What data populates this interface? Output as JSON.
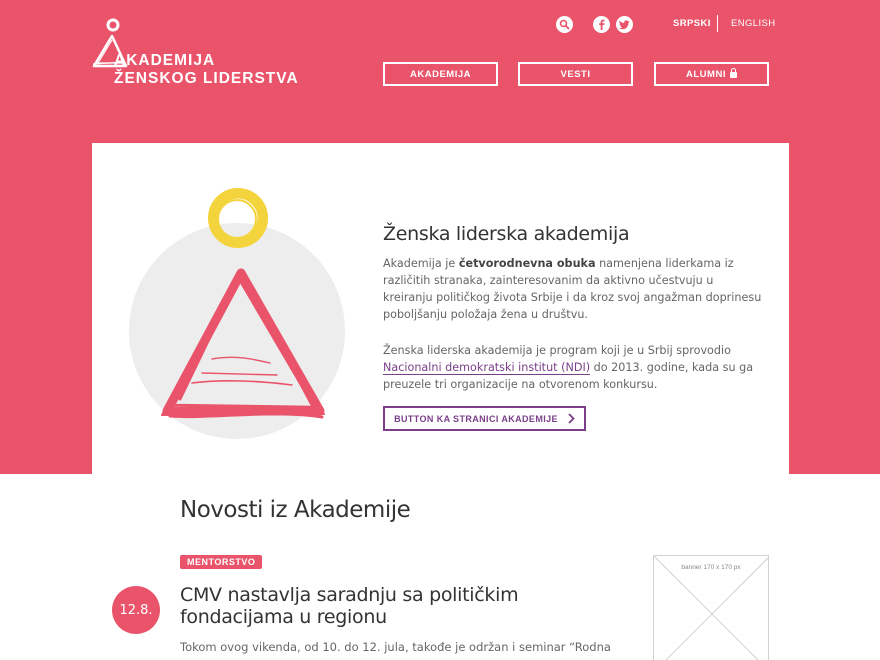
{
  "colors": {
    "brand": "#e9546b",
    "accent_purple": "#7b3f8a",
    "illustration_yellow": "#f3d43c"
  },
  "header": {
    "logo": {
      "line1": "AKADEMIJA",
      "line2": "ŽENSKOG LIDERSTVA"
    },
    "icons": {
      "search": "search-icon",
      "facebook": "facebook-icon",
      "twitter": "twitter-icon"
    },
    "languages": {
      "active": "SRPSKI",
      "other": "ENGLISH"
    },
    "nav": [
      {
        "label": "AKADEMIJA"
      },
      {
        "label": "VESTI"
      },
      {
        "label": "ALUMNI",
        "icon": "lock-icon"
      }
    ]
  },
  "hero": {
    "title": "Ženska liderska akademija",
    "p1_before": "Akademija je ",
    "p1_bold": "četvorodnevna obuka",
    "p1_after": " namenjena liderkama iz različitih stranaka, zainteresovanim da aktivno učestvuju u kreiranju političkog života Srbije i da kroz svoj angažman doprinesu poboljšanju položaja žena u društvu.",
    "p2_before": "Ženska liderska akademija je program koji je u Srbij sprovodio ",
    "p2_link": "Nacionalni demokratski institut (NDI)",
    "p2_after": " do 2013. godine, kada su ga preuzele tri organizacije na otvorenom konkursu.",
    "cta_label": "BUTTON KA STRANICI AKADEMIJE"
  },
  "news": {
    "section_title": "Novosti iz Akademije",
    "post": {
      "tag": "MENTORSTVO",
      "date": "12.8.",
      "title": "CMV nastavlja saradnju sa političkim fondacijama u regionu",
      "excerpt": "Tokom ovog vikenda, od 10. do 12. jula, takođe je održan i seminar “Rodna"
    },
    "banner_label": "banner 170 x 170 px"
  }
}
